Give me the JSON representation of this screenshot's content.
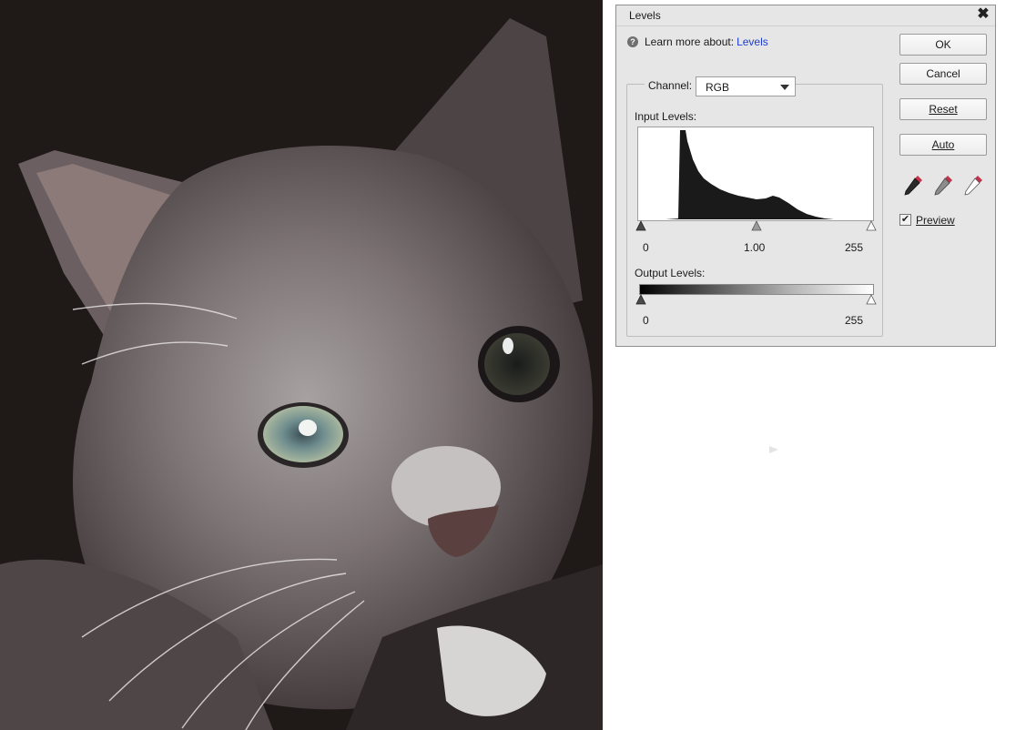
{
  "dialog": {
    "title": "Levels",
    "close_glyph": "✖",
    "help_icon": "question-circle-icon",
    "learn_prefix": "Learn more about:",
    "learn_link": "Levels",
    "channel_label": "Channel:",
    "channel_value": "RGB",
    "input_levels_label": "Input Levels:",
    "input_values": {
      "black": "0",
      "gamma": "1.00",
      "white": "255"
    },
    "output_levels_label": "Output Levels:",
    "output_values": {
      "black": "0",
      "white": "255"
    },
    "buttons": {
      "ok": "OK",
      "cancel": "Cancel",
      "reset": "Reset",
      "auto": "Auto"
    },
    "eyedroppers": [
      "black-eyedropper-icon",
      "gray-eyedropper-icon",
      "white-eyedropper-icon"
    ],
    "preview_label": "Preview",
    "preview_checked": true,
    "checkmark": "✔"
  },
  "colors": {
    "link": "#1d3ccf",
    "histogram": "#1a1a1a",
    "dialog_bg": "#e6e6e6"
  }
}
